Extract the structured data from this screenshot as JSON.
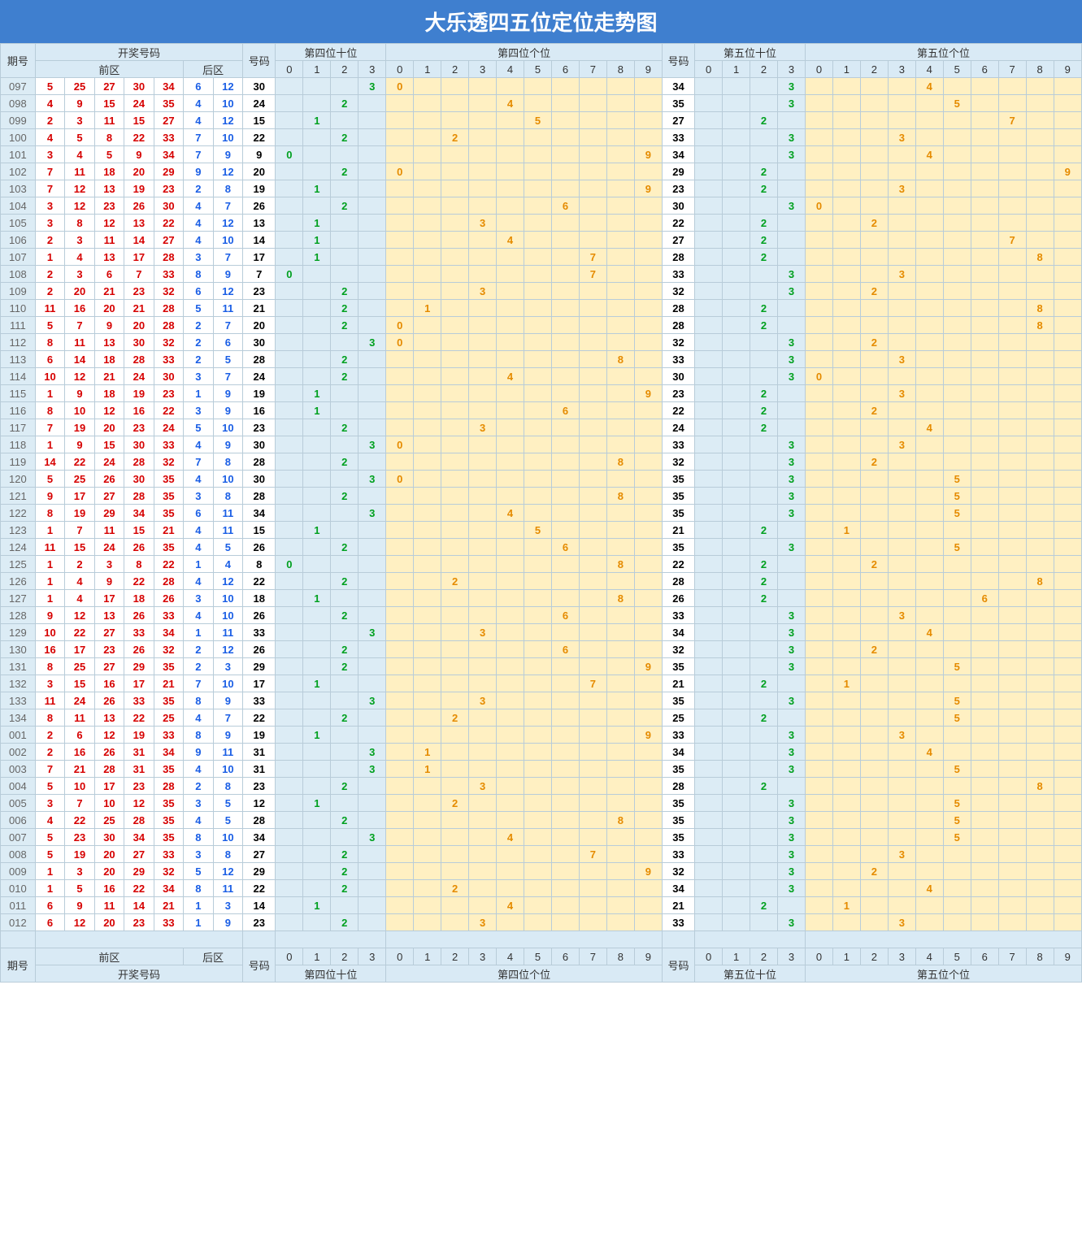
{
  "title": "大乐透四五位定位走势图",
  "header": {
    "period": "期号",
    "draw": "开奖号码",
    "front": "前区",
    "back": "后区",
    "code": "号码",
    "g4t": "第四位十位",
    "g4u": "第四位个位",
    "g5t": "第五位十位",
    "g5u": "第五位个位",
    "digits4t": [
      "0",
      "1",
      "2",
      "3"
    ],
    "digits": [
      "0",
      "1",
      "2",
      "3",
      "4",
      "5",
      "6",
      "7",
      "8",
      "9"
    ]
  },
  "rows": [
    {
      "p": "097",
      "f": [
        5,
        25,
        27,
        30,
        34
      ],
      "b": [
        6,
        12
      ],
      "c1": 30,
      "t1": {
        "3": "3"
      },
      "u1": {
        "0": "0"
      },
      "c2": 34,
      "t2": {
        "3": "3"
      },
      "u2": {
        "4": "4"
      }
    },
    {
      "p": "098",
      "f": [
        4,
        9,
        15,
        24,
        35
      ],
      "b": [
        4,
        10
      ],
      "c1": 24,
      "t1": {
        "2": "2"
      },
      "u1": {
        "4": "4"
      },
      "c2": 35,
      "t2": {
        "3": "3"
      },
      "u2": {
        "5": "5"
      }
    },
    {
      "p": "099",
      "f": [
        2,
        3,
        11,
        15,
        27
      ],
      "b": [
        4,
        12
      ],
      "c1": 15,
      "t1": {
        "1": "1"
      },
      "u1": {
        "5": "5"
      },
      "c2": 27,
      "t2": {
        "2": "2"
      },
      "u2": {
        "7": "7"
      }
    },
    {
      "p": "100",
      "f": [
        4,
        5,
        8,
        22,
        33
      ],
      "b": [
        7,
        10
      ],
      "c1": 22,
      "t1": {
        "2": "2"
      },
      "u1": {
        "2": "2"
      },
      "c2": 33,
      "t2": {
        "3": "3"
      },
      "u2": {
        "3": "3"
      }
    },
    {
      "p": "101",
      "f": [
        3,
        4,
        5,
        9,
        34
      ],
      "b": [
        7,
        9
      ],
      "c1": 9,
      "t1": {
        "0": "0"
      },
      "u1": {
        "9": "9"
      },
      "c2": 34,
      "t2": {
        "3": "3"
      },
      "u2": {
        "4": "4"
      }
    },
    {
      "p": "102",
      "f": [
        7,
        11,
        18,
        20,
        29
      ],
      "b": [
        9,
        12
      ],
      "c1": 20,
      "t1": {
        "2": "2"
      },
      "u1": {
        "0": "0"
      },
      "c2": 29,
      "t2": {
        "2": "2"
      },
      "u2": {
        "9": "9"
      }
    },
    {
      "p": "103",
      "f": [
        7,
        12,
        13,
        19,
        23
      ],
      "b": [
        2,
        8
      ],
      "c1": 19,
      "t1": {
        "1": "1"
      },
      "u1": {
        "9": "9"
      },
      "c2": 23,
      "t2": {
        "2": "2"
      },
      "u2": {
        "3": "3"
      }
    },
    {
      "p": "104",
      "f": [
        3,
        12,
        23,
        26,
        30
      ],
      "b": [
        4,
        7
      ],
      "c1": 26,
      "t1": {
        "2": "2"
      },
      "u1": {
        "6": "6"
      },
      "c2": 30,
      "t2": {
        "3": "3"
      },
      "u2": {
        "0": "0"
      }
    },
    {
      "p": "105",
      "f": [
        3,
        8,
        12,
        13,
        22
      ],
      "b": [
        4,
        12
      ],
      "c1": 13,
      "t1": {
        "1": "1"
      },
      "u1": {
        "3": "3"
      },
      "c2": 22,
      "t2": {
        "2": "2"
      },
      "u2": {
        "2": "2"
      }
    },
    {
      "p": "106",
      "f": [
        2,
        3,
        11,
        14,
        27
      ],
      "b": [
        4,
        10
      ],
      "c1": 14,
      "t1": {
        "1": "1"
      },
      "u1": {
        "4": "4"
      },
      "c2": 27,
      "t2": {
        "2": "2"
      },
      "u2": {
        "7": "7"
      }
    },
    {
      "p": "107",
      "f": [
        1,
        4,
        13,
        17,
        28
      ],
      "b": [
        3,
        7
      ],
      "c1": 17,
      "t1": {
        "1": "1"
      },
      "u1": {
        "7": "7"
      },
      "c2": 28,
      "t2": {
        "2": "2"
      },
      "u2": {
        "8": "8"
      }
    },
    {
      "p": "108",
      "f": [
        2,
        3,
        6,
        7,
        33
      ],
      "b": [
        8,
        9
      ],
      "c1": 7,
      "t1": {
        "0": "0"
      },
      "u1": {
        "7": "7"
      },
      "c2": 33,
      "t2": {
        "3": "3"
      },
      "u2": {
        "3": "3"
      }
    },
    {
      "p": "109",
      "f": [
        2,
        20,
        21,
        23,
        32
      ],
      "b": [
        6,
        12
      ],
      "c1": 23,
      "t1": {
        "2": "2"
      },
      "u1": {
        "3": "3"
      },
      "c2": 32,
      "t2": {
        "3": "3"
      },
      "u2": {
        "2": "2"
      }
    },
    {
      "p": "110",
      "f": [
        11,
        16,
        20,
        21,
        28
      ],
      "b": [
        5,
        11
      ],
      "c1": 21,
      "t1": {
        "2": "2"
      },
      "u1": {
        "1": "1"
      },
      "c2": 28,
      "t2": {
        "2": "2"
      },
      "u2": {
        "8": "8"
      }
    },
    {
      "p": "111",
      "f": [
        5,
        7,
        9,
        20,
        28
      ],
      "b": [
        2,
        7
      ],
      "c1": 20,
      "t1": {
        "2": "2"
      },
      "u1": {
        "0": "0"
      },
      "c2": 28,
      "t2": {
        "2": "2"
      },
      "u2": {
        "8": "8"
      }
    },
    {
      "p": "112",
      "f": [
        8,
        11,
        13,
        30,
        32
      ],
      "b": [
        2,
        6
      ],
      "c1": 30,
      "t1": {
        "3": "3"
      },
      "u1": {
        "0": "0"
      },
      "c2": 32,
      "t2": {
        "3": "3"
      },
      "u2": {
        "2": "2"
      }
    },
    {
      "p": "113",
      "f": [
        6,
        14,
        18,
        28,
        33
      ],
      "b": [
        2,
        5
      ],
      "c1": 28,
      "t1": {
        "2": "2"
      },
      "u1": {
        "8": "8"
      },
      "c2": 33,
      "t2": {
        "3": "3"
      },
      "u2": {
        "3": "3"
      }
    },
    {
      "p": "114",
      "f": [
        10,
        12,
        21,
        24,
        30
      ],
      "b": [
        3,
        7
      ],
      "c1": 24,
      "t1": {
        "2": "2"
      },
      "u1": {
        "4": "4"
      },
      "c2": 30,
      "t2": {
        "3": "3"
      },
      "u2": {
        "0": "0"
      }
    },
    {
      "p": "115",
      "f": [
        1,
        9,
        18,
        19,
        23
      ],
      "b": [
        1,
        9
      ],
      "c1": 19,
      "t1": {
        "1": "1"
      },
      "u1": {
        "9": "9"
      },
      "c2": 23,
      "t2": {
        "2": "2"
      },
      "u2": {
        "3": "3"
      }
    },
    {
      "p": "116",
      "f": [
        8,
        10,
        12,
        16,
        22
      ],
      "b": [
        3,
        9
      ],
      "c1": 16,
      "t1": {
        "1": "1"
      },
      "u1": {
        "6": "6"
      },
      "c2": 22,
      "t2": {
        "2": "2"
      },
      "u2": {
        "2": "2"
      }
    },
    {
      "p": "117",
      "f": [
        7,
        19,
        20,
        23,
        24
      ],
      "b": [
        5,
        10
      ],
      "c1": 23,
      "t1": {
        "2": "2"
      },
      "u1": {
        "3": "3"
      },
      "c2": 24,
      "t2": {
        "2": "2"
      },
      "u2": {
        "4": "4"
      }
    },
    {
      "p": "118",
      "f": [
        1,
        9,
        15,
        30,
        33
      ],
      "b": [
        4,
        9
      ],
      "c1": 30,
      "t1": {
        "3": "3"
      },
      "u1": {
        "0": "0"
      },
      "c2": 33,
      "t2": {
        "3": "3"
      },
      "u2": {
        "3": "3"
      }
    },
    {
      "p": "119",
      "f": [
        14,
        22,
        24,
        28,
        32
      ],
      "b": [
        7,
        8
      ],
      "c1": 28,
      "t1": {
        "2": "2"
      },
      "u1": {
        "8": "8"
      },
      "c2": 32,
      "t2": {
        "3": "3"
      },
      "u2": {
        "2": "2"
      }
    },
    {
      "p": "120",
      "f": [
        5,
        25,
        26,
        30,
        35
      ],
      "b": [
        4,
        10
      ],
      "c1": 30,
      "t1": {
        "3": "3"
      },
      "u1": {
        "0": "0"
      },
      "c2": 35,
      "t2": {
        "3": "3"
      },
      "u2": {
        "5": "5"
      }
    },
    {
      "p": "121",
      "f": [
        9,
        17,
        27,
        28,
        35
      ],
      "b": [
        3,
        8
      ],
      "c1": 28,
      "t1": {
        "2": "2"
      },
      "u1": {
        "8": "8"
      },
      "c2": 35,
      "t2": {
        "3": "3"
      },
      "u2": {
        "5": "5"
      }
    },
    {
      "p": "122",
      "f": [
        8,
        19,
        29,
        34,
        35
      ],
      "b": [
        6,
        11
      ],
      "c1": 34,
      "t1": {
        "3": "3"
      },
      "u1": {
        "4": "4"
      },
      "c2": 35,
      "t2": {
        "3": "3"
      },
      "u2": {
        "5": "5"
      }
    },
    {
      "p": "123",
      "f": [
        1,
        7,
        11,
        15,
        21
      ],
      "b": [
        4,
        11
      ],
      "c1": 15,
      "t1": {
        "1": "1"
      },
      "u1": {
        "5": "5"
      },
      "c2": 21,
      "t2": {
        "2": "2"
      },
      "u2": {
        "1": "1"
      }
    },
    {
      "p": "124",
      "f": [
        11,
        15,
        24,
        26,
        35
      ],
      "b": [
        4,
        5
      ],
      "c1": 26,
      "t1": {
        "2": "2"
      },
      "u1": {
        "6": "6"
      },
      "c2": 35,
      "t2": {
        "3": "3"
      },
      "u2": {
        "5": "5"
      }
    },
    {
      "p": "125",
      "f": [
        1,
        2,
        3,
        8,
        22
      ],
      "b": [
        1,
        4
      ],
      "c1": 8,
      "t1": {
        "0": "0"
      },
      "u1": {
        "8": "8"
      },
      "c2": 22,
      "t2": {
        "2": "2"
      },
      "u2": {
        "2": "2"
      }
    },
    {
      "p": "126",
      "f": [
        1,
        4,
        9,
        22,
        28
      ],
      "b": [
        4,
        12
      ],
      "c1": 22,
      "t1": {
        "2": "2"
      },
      "u1": {
        "2": "2"
      },
      "c2": 28,
      "t2": {
        "2": "2"
      },
      "u2": {
        "8": "8"
      }
    },
    {
      "p": "127",
      "f": [
        1,
        4,
        17,
        18,
        26
      ],
      "b": [
        3,
        10
      ],
      "c1": 18,
      "t1": {
        "1": "1"
      },
      "u1": {
        "8": "8"
      },
      "c2": 26,
      "t2": {
        "2": "2"
      },
      "u2": {
        "6": "6"
      }
    },
    {
      "p": "128",
      "f": [
        9,
        12,
        13,
        26,
        33
      ],
      "b": [
        4,
        10
      ],
      "c1": 26,
      "t1": {
        "2": "2"
      },
      "u1": {
        "6": "6"
      },
      "c2": 33,
      "t2": {
        "3": "3"
      },
      "u2": {
        "3": "3"
      }
    },
    {
      "p": "129",
      "f": [
        10,
        22,
        27,
        33,
        34
      ],
      "b": [
        1,
        11
      ],
      "c1": 33,
      "t1": {
        "3": "3"
      },
      "u1": {
        "3": "3"
      },
      "c2": 34,
      "t2": {
        "3": "3"
      },
      "u2": {
        "4": "4"
      }
    },
    {
      "p": "130",
      "f": [
        16,
        17,
        23,
        26,
        32
      ],
      "b": [
        2,
        12
      ],
      "c1": 26,
      "t1": {
        "2": "2"
      },
      "u1": {
        "6": "6"
      },
      "c2": 32,
      "t2": {
        "3": "3"
      },
      "u2": {
        "2": "2"
      }
    },
    {
      "p": "131",
      "f": [
        8,
        25,
        27,
        29,
        35
      ],
      "b": [
        2,
        3
      ],
      "c1": 29,
      "t1": {
        "2": "2"
      },
      "u1": {
        "9": "9"
      },
      "c2": 35,
      "t2": {
        "3": "3"
      },
      "u2": {
        "5": "5"
      }
    },
    {
      "p": "132",
      "f": [
        3,
        15,
        16,
        17,
        21
      ],
      "b": [
        7,
        10
      ],
      "c1": 17,
      "t1": {
        "1": "1"
      },
      "u1": {
        "7": "7"
      },
      "c2": 21,
      "t2": {
        "2": "2"
      },
      "u2": {
        "1": "1"
      }
    },
    {
      "p": "133",
      "f": [
        11,
        24,
        26,
        33,
        35
      ],
      "b": [
        8,
        9
      ],
      "c1": 33,
      "t1": {
        "3": "3"
      },
      "u1": {
        "3": "3"
      },
      "c2": 35,
      "t2": {
        "3": "3"
      },
      "u2": {
        "5": "5"
      }
    },
    {
      "p": "134",
      "f": [
        8,
        11,
        13,
        22,
        25
      ],
      "b": [
        4,
        7
      ],
      "c1": 22,
      "t1": {
        "2": "2"
      },
      "u1": {
        "2": "2"
      },
      "c2": 25,
      "t2": {
        "2": "2"
      },
      "u2": {
        "5": "5"
      }
    },
    {
      "p": "001",
      "f": [
        2,
        6,
        12,
        19,
        33
      ],
      "b": [
        8,
        9
      ],
      "c1": 19,
      "t1": {
        "1": "1"
      },
      "u1": {
        "9": "9"
      },
      "c2": 33,
      "t2": {
        "3": "3"
      },
      "u2": {
        "3": "3"
      }
    },
    {
      "p": "002",
      "f": [
        2,
        16,
        26,
        31,
        34
      ],
      "b": [
        9,
        11
      ],
      "c1": 31,
      "t1": {
        "3": "3"
      },
      "u1": {
        "1": "1"
      },
      "c2": 34,
      "t2": {
        "3": "3"
      },
      "u2": {
        "4": "4"
      }
    },
    {
      "p": "003",
      "f": [
        7,
        21,
        28,
        31,
        35
      ],
      "b": [
        4,
        10
      ],
      "c1": 31,
      "t1": {
        "3": "3"
      },
      "u1": {
        "1": "1"
      },
      "c2": 35,
      "t2": {
        "3": "3"
      },
      "u2": {
        "5": "5"
      }
    },
    {
      "p": "004",
      "f": [
        5,
        10,
        17,
        23,
        28
      ],
      "b": [
        2,
        8
      ],
      "c1": 23,
      "t1": {
        "2": "2"
      },
      "u1": {
        "3": "3"
      },
      "c2": 28,
      "t2": {
        "2": "2"
      },
      "u2": {
        "8": "8"
      }
    },
    {
      "p": "005",
      "f": [
        3,
        7,
        10,
        12,
        35
      ],
      "b": [
        3,
        5
      ],
      "c1": 12,
      "t1": {
        "1": "1"
      },
      "u1": {
        "2": "2"
      },
      "c2": 35,
      "t2": {
        "3": "3"
      },
      "u2": {
        "5": "5"
      }
    },
    {
      "p": "006",
      "f": [
        4,
        22,
        25,
        28,
        35
      ],
      "b": [
        4,
        5
      ],
      "c1": 28,
      "t1": {
        "2": "2"
      },
      "u1": {
        "8": "8"
      },
      "c2": 35,
      "t2": {
        "3": "3"
      },
      "u2": {
        "5": "5"
      }
    },
    {
      "p": "007",
      "f": [
        5,
        23,
        30,
        34,
        35
      ],
      "b": [
        8,
        10
      ],
      "c1": 34,
      "t1": {
        "3": "3"
      },
      "u1": {
        "4": "4"
      },
      "c2": 35,
      "t2": {
        "3": "3"
      },
      "u2": {
        "5": "5"
      }
    },
    {
      "p": "008",
      "f": [
        5,
        19,
        20,
        27,
        33
      ],
      "b": [
        3,
        8
      ],
      "c1": 27,
      "t1": {
        "2": "2"
      },
      "u1": {
        "7": "7"
      },
      "c2": 33,
      "t2": {
        "3": "3"
      },
      "u2": {
        "3": "3"
      }
    },
    {
      "p": "009",
      "f": [
        1,
        3,
        20,
        29,
        32
      ],
      "b": [
        5,
        12
      ],
      "c1": 29,
      "t1": {
        "2": "2"
      },
      "u1": {
        "9": "9"
      },
      "c2": 32,
      "t2": {
        "3": "3"
      },
      "u2": {
        "2": "2"
      }
    },
    {
      "p": "010",
      "f": [
        1,
        5,
        16,
        22,
        34
      ],
      "b": [
        8,
        11
      ],
      "c1": 22,
      "t1": {
        "2": "2"
      },
      "u1": {
        "2": "2"
      },
      "c2": 34,
      "t2": {
        "3": "3"
      },
      "u2": {
        "4": "4"
      }
    },
    {
      "p": "011",
      "f": [
        6,
        9,
        11,
        14,
        21
      ],
      "b": [
        1,
        3
      ],
      "c1": 14,
      "t1": {
        "1": "1"
      },
      "u1": {
        "4": "4"
      },
      "c2": 21,
      "t2": {
        "2": "2"
      },
      "u2": {
        "1": "1"
      }
    },
    {
      "p": "012",
      "f": [
        6,
        12,
        20,
        23,
        33
      ],
      "b": [
        1,
        9
      ],
      "c1": 23,
      "t1": {
        "2": "2"
      },
      "u1": {
        "3": "3"
      },
      "c2": 33,
      "t2": {
        "3": "3"
      },
      "u2": {
        "3": "3"
      }
    }
  ]
}
